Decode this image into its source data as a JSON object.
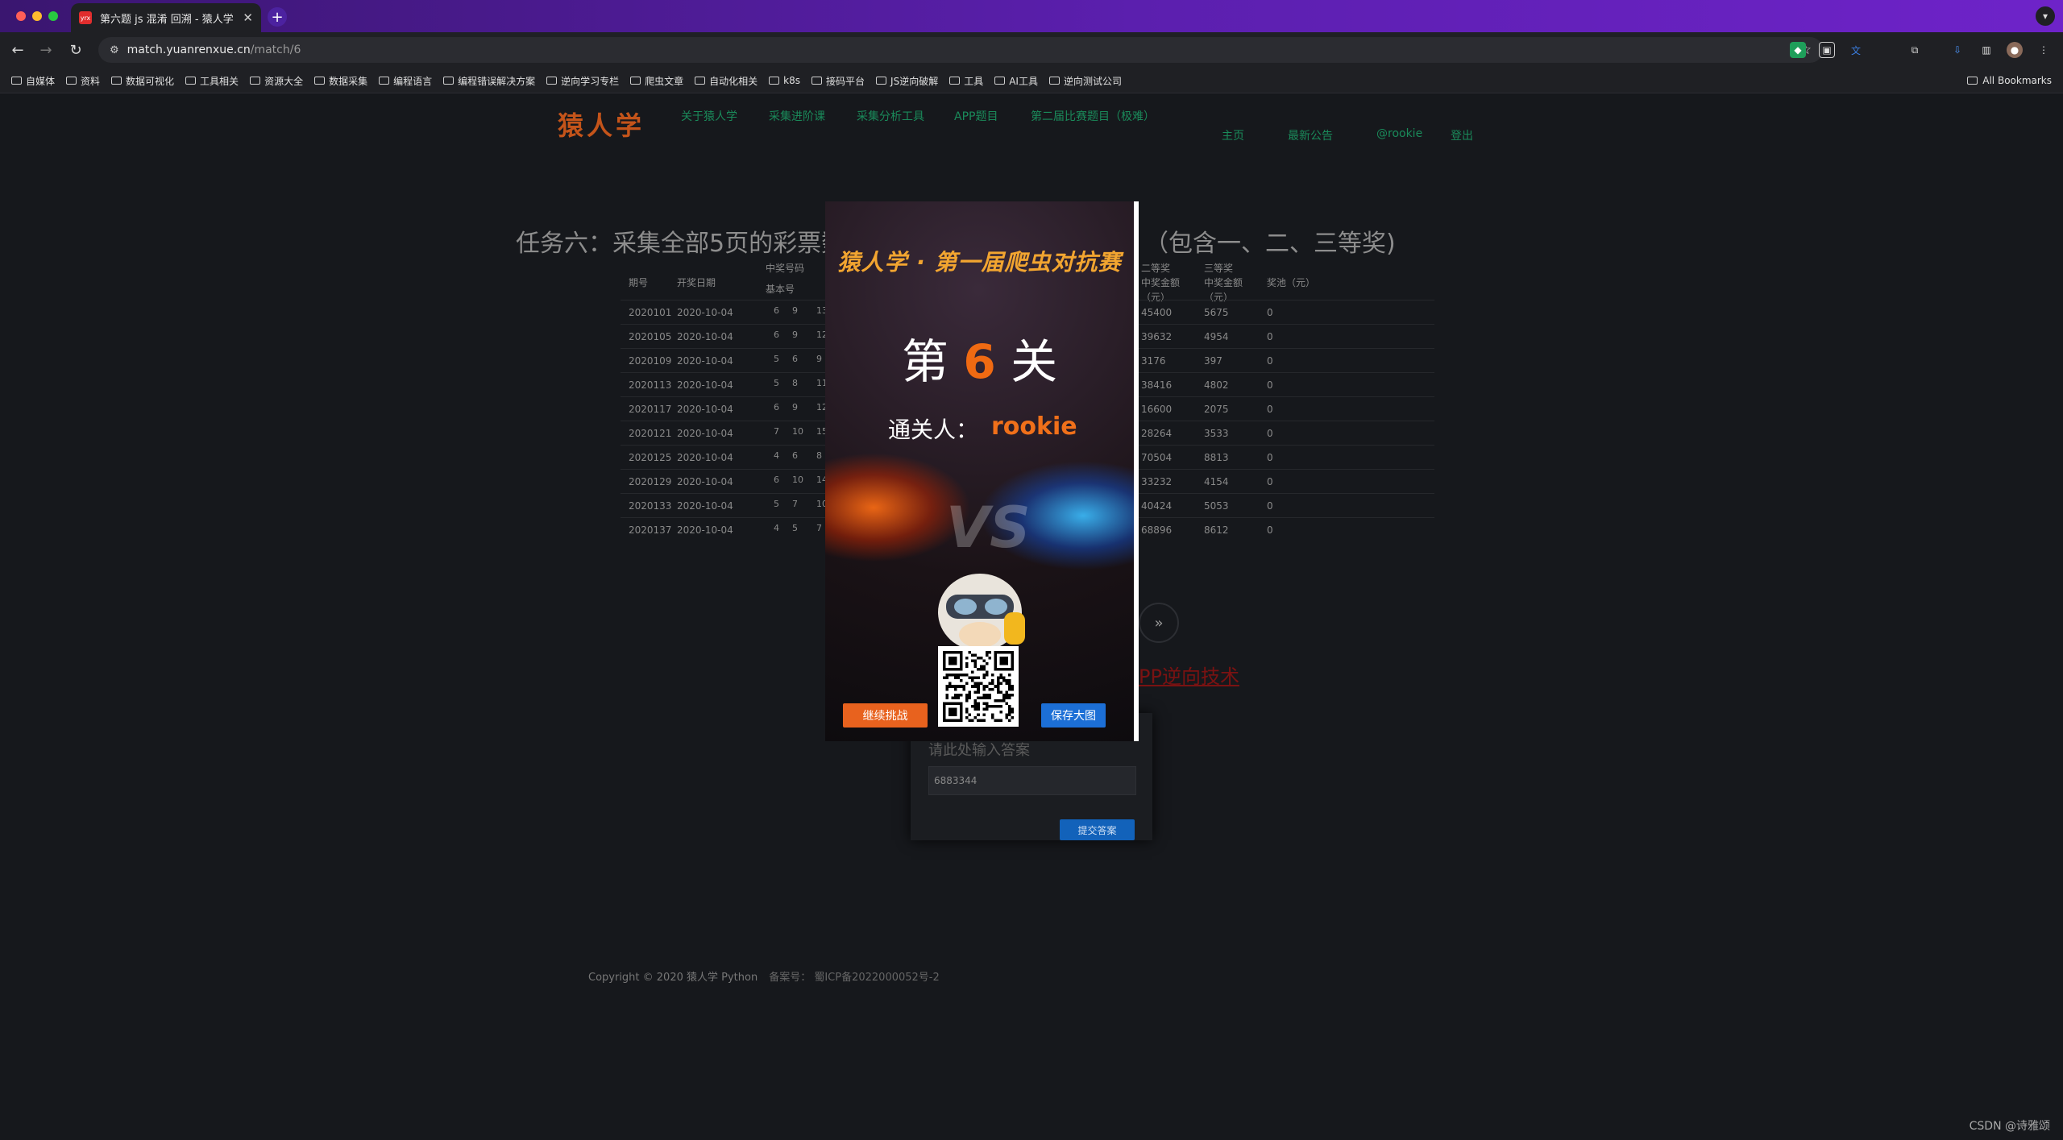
{
  "browser": {
    "tab_title": "第六题 js 混淆 回溯 - 猿人学",
    "favicon_text": "yrx",
    "url_host": "match.yuanrenxue.cn",
    "url_path": "/match/6",
    "bookmarks": [
      "自媒体",
      "资料",
      "数据可视化",
      "工具相关",
      "资源大全",
      "数据采集",
      "编程语言",
      "编程错误解决方案",
      "逆向学习专栏",
      "爬虫文章",
      "自动化相关",
      "k8s",
      "接码平台",
      "JS逆向破解",
      "工具",
      "AI工具",
      "逆向测试公司"
    ],
    "all_bookmarks": "All Bookmarks"
  },
  "site": {
    "logo": "猿人学",
    "nav": [
      "关于猿人学",
      "采集进阶课",
      "采集分析工具",
      "APP题目",
      "第二届比赛题目（极难）"
    ],
    "nav_right": [
      "主页",
      "最新公告",
      "@rookie",
      "登出"
    ]
  },
  "task": {
    "title": "任务六：采集全部5页的彩票数",
    "title_suffix": "（包含一、二、三等奖)"
  },
  "table": {
    "headers": {
      "issue": "期号",
      "date": "开奖日期",
      "winning_numbers": "中奖号码",
      "basic": "基本号",
      "second_prize": "二等奖",
      "second_amount": "中奖金额（元）",
      "third_prize": "三等奖",
      "third_amount": "中奖金额（元）",
      "pool": "奖池（元）"
    },
    "rows": [
      {
        "issue": "2020101",
        "date": "2020-10-04",
        "n1": "6",
        "n2": "9",
        "n3": "13",
        "second": "45400",
        "third": "5675",
        "pool": "0"
      },
      {
        "issue": "2020105",
        "date": "2020-10-04",
        "n1": "6",
        "n2": "9",
        "n3": "12",
        "second": "39632",
        "third": "4954",
        "pool": "0"
      },
      {
        "issue": "2020109",
        "date": "2020-10-04",
        "n1": "5",
        "n2": "6",
        "n3": "9",
        "second": "3176",
        "third": "397",
        "pool": "0"
      },
      {
        "issue": "2020113",
        "date": "2020-10-04",
        "n1": "5",
        "n2": "8",
        "n3": "11",
        "second": "38416",
        "third": "4802",
        "pool": "0"
      },
      {
        "issue": "2020117",
        "date": "2020-10-04",
        "n1": "6",
        "n2": "9",
        "n3": "12",
        "second": "16600",
        "third": "2075",
        "pool": "0"
      },
      {
        "issue": "2020121",
        "date": "2020-10-04",
        "n1": "7",
        "n2": "10",
        "n3": "15",
        "second": "28264",
        "third": "3533",
        "pool": "0"
      },
      {
        "issue": "2020125",
        "date": "2020-10-04",
        "n1": "4",
        "n2": "6",
        "n3": "8",
        "second": "70504",
        "third": "8813",
        "pool": "0"
      },
      {
        "issue": "2020129",
        "date": "2020-10-04",
        "n1": "6",
        "n2": "10",
        "n3": "14",
        "second": "33232",
        "third": "4154",
        "pool": "0"
      },
      {
        "issue": "2020133",
        "date": "2020-10-04",
        "n1": "5",
        "n2": "7",
        "n3": "10",
        "second": "40424",
        "third": "5053",
        "pool": "0"
      },
      {
        "issue": "2020137",
        "date": "2020-10-04",
        "n1": "4",
        "n2": "5",
        "n3": "7",
        "second": "68896",
        "third": "8612",
        "pool": "0"
      }
    ]
  },
  "pager": {
    "next": "»"
  },
  "promo": {
    "link_text": "PP逆向技术"
  },
  "answer": {
    "label": "请此处输入答案",
    "value": "6883344",
    "submit": "提交答案"
  },
  "footer": {
    "copyright": "Copyright © 2020 猿人学 Python",
    "icp": "备案号： 蜀ICP备2022000052号-2"
  },
  "watermark": "CSDN @诗雅颂",
  "modal": {
    "heading": "猿人学 · 第一届爬虫对抗赛",
    "level_prefix": "第",
    "level_number": "6",
    "level_suffix": "关",
    "winner_label": "通关人：",
    "winner_name": "rookie",
    "vs": "VS",
    "continue_label": "继续挑战",
    "save_label": "保存大图"
  },
  "colors": {
    "accent_orange": "#f06a12",
    "nav_green": "#1a8a5a",
    "submit_blue": "#1262ba",
    "save_blue": "#1c6fd6",
    "continue_orange": "#e8621e"
  }
}
